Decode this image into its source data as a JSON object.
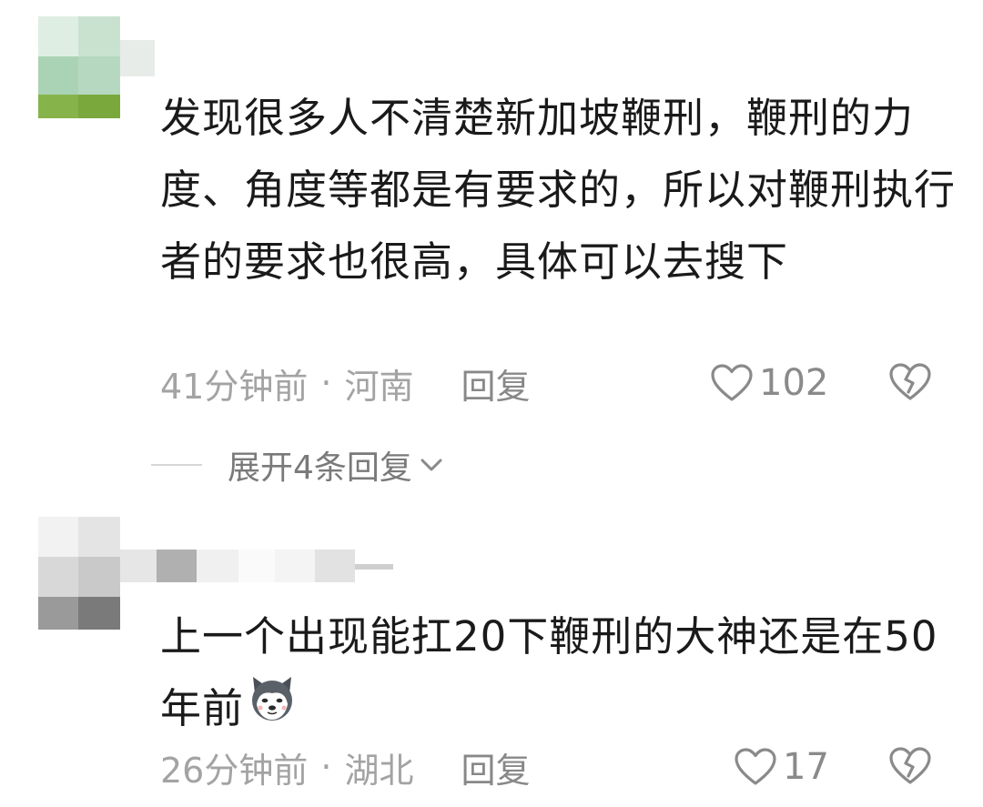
{
  "comments": [
    {
      "text": "发现很多人不清楚新加坡鞭刑，鞭刑的力度、角度等都是有要求的，所以对鞭刑执行者的要求也很高，具体可以去搜下",
      "time": "41分钟前",
      "separator": "·",
      "location": "河南",
      "reply_label": "回复",
      "like_count": "102",
      "expand_label": "展开4条回复"
    },
    {
      "text": "上一个出现能扛20下鞭刑的大神还是在50年前",
      "time": "26分钟前",
      "separator": "·",
      "location": "湖北",
      "reply_label": "回复",
      "like_count": "17"
    }
  ],
  "icons": {
    "like": "heart-outline-icon",
    "dislike": "broken-heart-icon",
    "expand": "chevron-down-icon",
    "emoji": "husky-dog-emoji"
  },
  "colors": {
    "text_primary": "#1a1a1a",
    "text_meta": "#a3a3a3",
    "icon_gray": "#8a8a8a"
  }
}
